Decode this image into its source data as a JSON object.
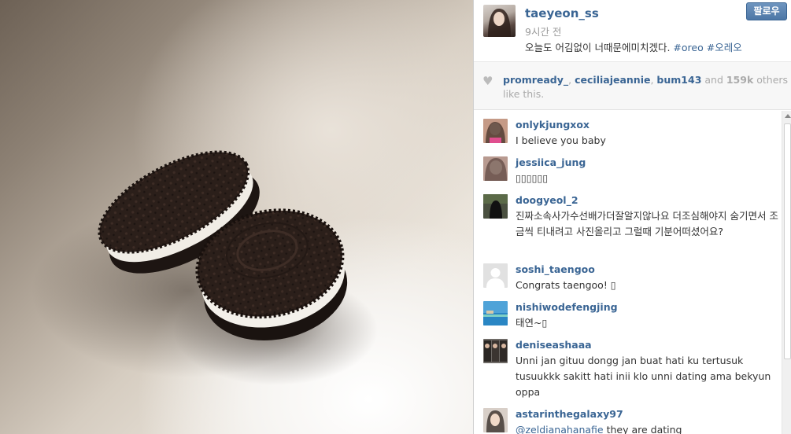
{
  "post": {
    "username": "taeyeon_ss",
    "time": "9시간 전",
    "caption": "오늘도 어김없이 너때문에미치겠다.",
    "hashtags": [
      "#oreo",
      "#오레오"
    ],
    "follow_label": "팔로우"
  },
  "likes": {
    "users": [
      "promready_",
      "ceciliajeannie",
      "bum143"
    ],
    "separator": ", ",
    "and_text": " and ",
    "count": "159k",
    "suffix": " others like this."
  },
  "comments": [
    {
      "user": "onlykjungxox",
      "text": "I believe you baby"
    },
    {
      "user": "jessiica_jung",
      "text": "▯▯▯▯▯▯"
    },
    {
      "user": "doogyeol_2",
      "text": "진짜소속사가수선배가더잘알지않나요 더조심해야지 숨기면서 조금씩 티내려고 사진올리고 그럴때 기분어떠셨어요?"
    },
    {
      "user": "soshi_taengoo",
      "text": "Congrats taengoo! ▯"
    },
    {
      "user": "nishiwodefengjing",
      "text": "태연~▯"
    },
    {
      "user": "deniseashaaa",
      "text": "Unni jan gituu dongg jan buat hati ku tertusuk tusuukkk sakitt hati inii klo unni dating ama bekyun oppa"
    },
    {
      "user": "astarinthegalaxy97",
      "mention": "@zeldianahanafie",
      "text": " they are dating"
    }
  ],
  "colors": {
    "link": "#3a6594",
    "follow_button": "#4d77a6"
  },
  "icons": {
    "like": "heart-icon",
    "scroll_up": "scroll-up-arrow-icon"
  }
}
